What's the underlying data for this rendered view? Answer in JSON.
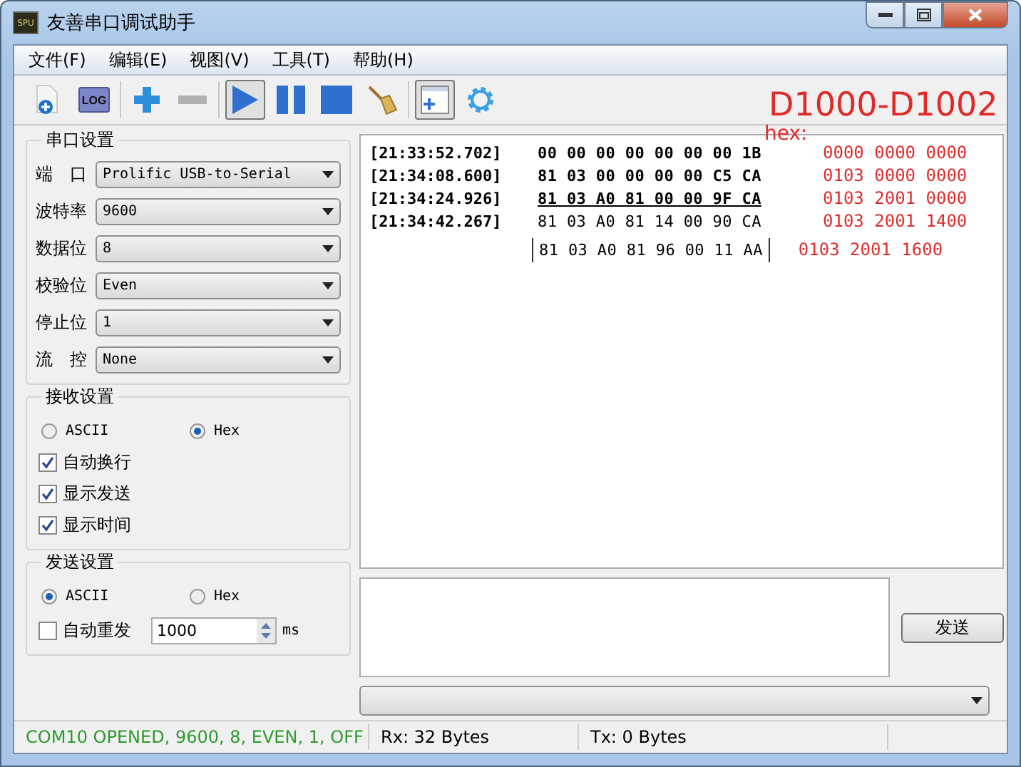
{
  "window": {
    "title": "友善串口调试助手",
    "app_icon": "SPU"
  },
  "menu": [
    "文件(F)",
    "编辑(E)",
    "视图(V)",
    "工具(T)",
    "帮助(H)"
  ],
  "toolbar": [
    {
      "kind": "new-file",
      "pressed": false
    },
    {
      "kind": "log",
      "label": "LOG",
      "pressed": false
    },
    {
      "kind": "sep"
    },
    {
      "kind": "plus",
      "pressed": false
    },
    {
      "kind": "minus",
      "pressed": false
    },
    {
      "kind": "sep"
    },
    {
      "kind": "play",
      "pressed": true
    },
    {
      "kind": "pause",
      "pressed": false
    },
    {
      "kind": "stop",
      "pressed": false
    },
    {
      "kind": "broom",
      "pressed": false
    },
    {
      "kind": "sep"
    },
    {
      "kind": "window-add",
      "pressed": true
    },
    {
      "kind": "gear",
      "pressed": false
    }
  ],
  "serial_settings": {
    "title": "串口设置",
    "fields": [
      {
        "label": "端　口",
        "value": "Prolific USB-to-Serial"
      },
      {
        "label": "波特率",
        "value": "9600"
      },
      {
        "label": "数据位",
        "value": "8"
      },
      {
        "label": "校验位",
        "value": "Even"
      },
      {
        "label": "停止位",
        "value": "1"
      },
      {
        "label": "流　控",
        "value": "None"
      }
    ]
  },
  "receive_settings": {
    "title": "接收设置",
    "modes": [
      {
        "label": "ASCII",
        "selected": false
      },
      {
        "label": "Hex",
        "selected": true
      }
    ],
    "options": [
      {
        "label": "自动换行",
        "checked": true
      },
      {
        "label": "显示发送",
        "checked": true
      },
      {
        "label": "显示时间",
        "checked": true
      }
    ]
  },
  "send_settings": {
    "title": "发送设置",
    "modes": [
      {
        "label": "ASCII",
        "selected": true
      },
      {
        "label": "Hex",
        "selected": false
      }
    ],
    "auto_resend": {
      "label": "自动重发",
      "checked": false,
      "value": "1000",
      "unit": "ms"
    }
  },
  "receive_log": [
    {
      "time": "[21:33:52.702]",
      "bytes": "00 00 00 00 00 00 00 1B",
      "kind": "bold"
    },
    {
      "time": "[21:34:08.600]",
      "bytes": "81 03 00 00 00 00 C5 CA",
      "kind": "bold"
    },
    {
      "time": "[21:34:24.926]",
      "bytes": "81 03 A0 81 00 00 9F CA",
      "kind": "underlined"
    },
    {
      "time": "[21:34:42.267]",
      "bytes": "81 03 A0 81 14 00 90 CA",
      "kind": "plain"
    },
    {
      "bytes": "81 03 A0 81 96 00 11 AA",
      "kind": "cursor"
    }
  ],
  "annotations": {
    "title": "D1000-D1002",
    "label": "hex:",
    "notes": [
      "0000 0000 0000",
      "0103 0000 0000",
      "0103 2001 0000",
      "0103 2001 1400",
      "0103 2001 1600"
    ]
  },
  "send_button": "发送",
  "status_bar": {
    "port": "COM10 OPENED, 9600, 8, EVEN, 1, OFF",
    "rx": "Rx: 32 Bytes",
    "tx": "Tx: 0 Bytes"
  }
}
